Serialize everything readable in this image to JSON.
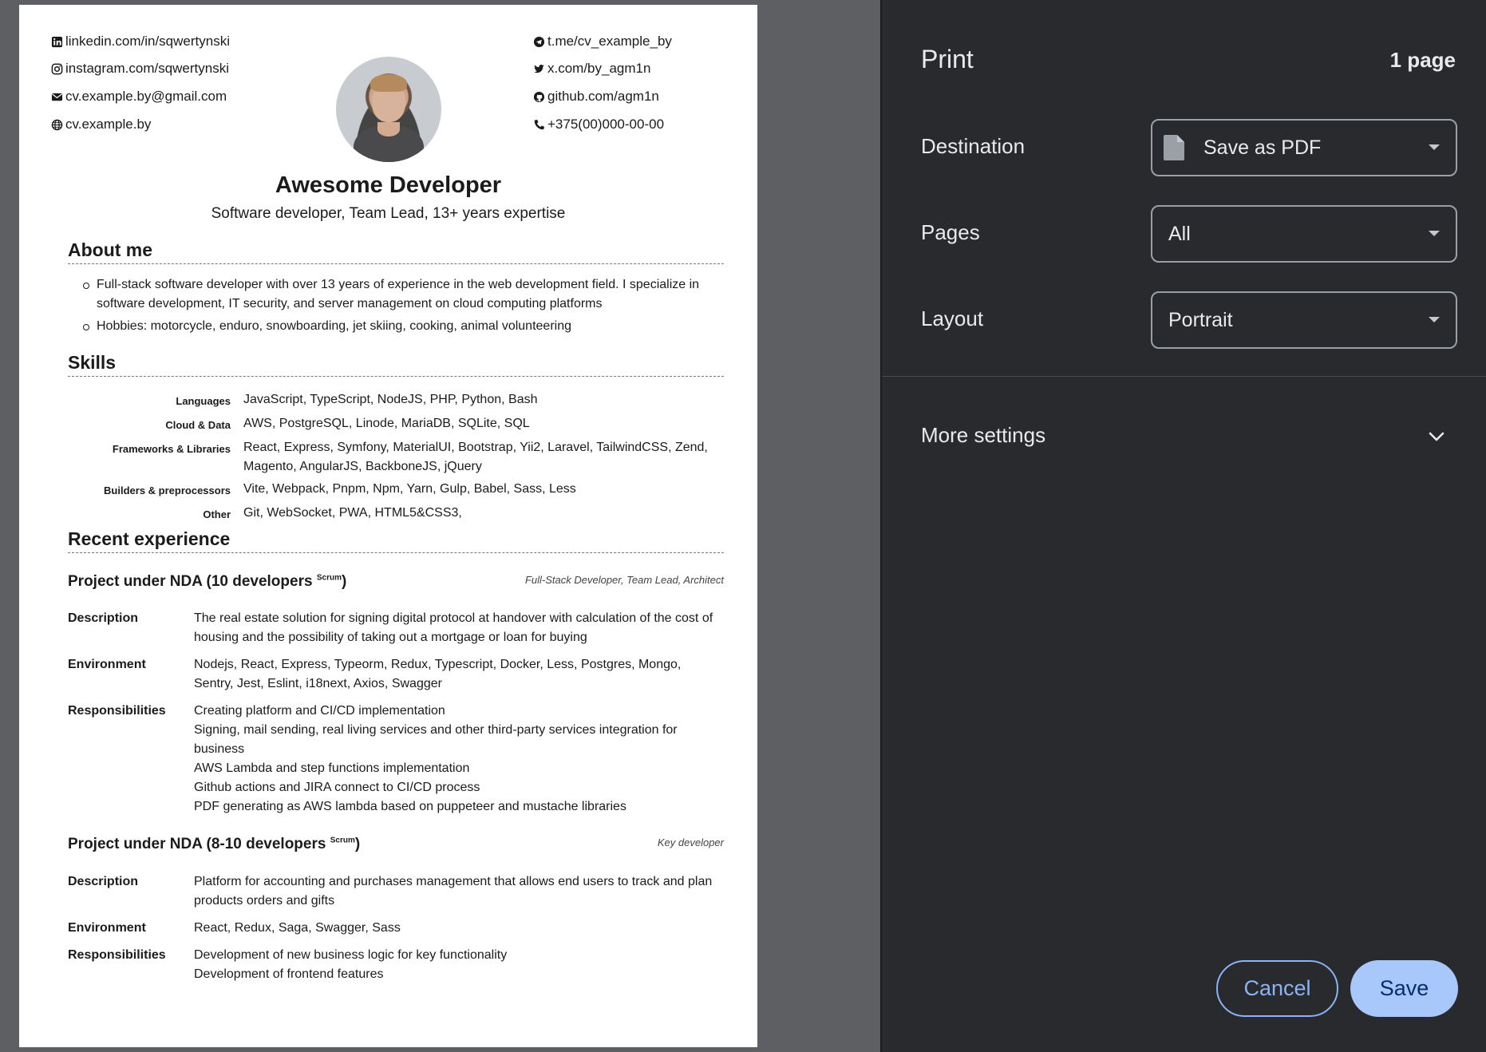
{
  "resume": {
    "contacts_left": [
      {
        "icon": "linkedin-icon",
        "text": "linkedin.com/in/sqwertynski"
      },
      {
        "icon": "instagram-icon",
        "text": "instagram.com/sqwertynski"
      },
      {
        "icon": "mail-icon",
        "text": "cv.example.by@gmail.com"
      },
      {
        "icon": "globe-icon",
        "text": "cv.example.by"
      }
    ],
    "contacts_right": [
      {
        "icon": "telegram-icon",
        "text": "t.me/cv_example_by"
      },
      {
        "icon": "twitter-icon",
        "text": "x.com/by_agm1n"
      },
      {
        "icon": "github-icon",
        "text": "github.com/agm1n"
      },
      {
        "icon": "phone-icon",
        "text": "+375(00)000-00-00"
      }
    ],
    "name": "Awesome Developer",
    "subtitle": "Software developer, Team Lead, 13+ years expertise",
    "about": {
      "heading": "About me",
      "items": [
        "Full-stack software developer with over 13 years of experience in the web development field. I specialize in software development, IT security, and server management on cloud computing platforms",
        "Hobbies: motorcycle, enduro, snowboarding, jet skiing, cooking, animal volunteering"
      ]
    },
    "skills": {
      "heading": "Skills",
      "rows": [
        {
          "key": "Languages",
          "value": "JavaScript, TypeScript, NodeJS, PHP, Python, Bash"
        },
        {
          "key": "Cloud & Data",
          "value": "AWS, PostgreSQL, Linode, MariaDB, SQLite, SQL"
        },
        {
          "key": "Frameworks & Libraries",
          "value": "React, Express, Symfony, MaterialUI, Bootstrap, Yii2, Laravel, TailwindCSS, Zend, Magento, AngularJS, BackboneJS, jQuery"
        },
        {
          "key": "Builders & preprocessors",
          "value": "Vite, Webpack, Pnpm, Npm, Yarn, Gulp, Babel, Sass, Less"
        },
        {
          "key": "Other",
          "value": "Git, WebSocket, PWA, HTML5&CSS3,"
        }
      ]
    },
    "experience": {
      "heading": "Recent experience",
      "projects": [
        {
          "title": "Project under NDA (10 developers",
          "sup": "Scrum",
          "close": ")",
          "role": "Full-Stack Developer, Team Lead, Architect",
          "labels": {
            "description": "Description",
            "environment": "Environment",
            "responsibilities": "Responsibilities"
          },
          "description": "The real estate solution for signing digital protocol at handover with calculation of the cost of housing and the possibility of taking out a mortgage or loan for buying",
          "environment": "Nodejs, React, Express, Typeorm, Redux, Typescript, Docker, Less, Postgres, Mongo, Sentry, Jest, Eslint, i18next, Axios, Swagger",
          "responsibilities": [
            "Creating platform and CI/CD implementation",
            "Signing, mail sending, real living services and other third-party services integration for business",
            "AWS Lambda and step functions implementation",
            "Github actions and JIRA connect to CI/CD process",
            "PDF generating as AWS lambda based on puppeteer and mustache libraries"
          ]
        },
        {
          "title": "Project under NDA (8-10 developers",
          "sup": "Scrum",
          "close": ")",
          "role": "Key developer",
          "labels": {
            "description": "Description",
            "environment": "Environment",
            "responsibilities": "Responsibilities"
          },
          "description": "Platform for accounting and purchases management that allows end users to track and plan products orders and gifts",
          "environment": "React, Redux, Saga, Swagger, Sass",
          "responsibilities": [
            "Development of new business logic for key functionality",
            "Development of frontend features"
          ]
        }
      ]
    }
  },
  "print_panel": {
    "title": "Print",
    "page_count": "1 page",
    "destination": {
      "label": "Destination",
      "value": "Save as PDF",
      "icon": "document-icon"
    },
    "pages": {
      "label": "Pages",
      "value": "All"
    },
    "layout": {
      "label": "Layout",
      "value": "Portrait"
    },
    "more_settings": "More settings",
    "cancel": "Cancel",
    "save": "Save",
    "colors": {
      "panel_bg": "#292a2d",
      "accent": "#8ab4f8",
      "save_bg": "#a8c7fa"
    }
  }
}
